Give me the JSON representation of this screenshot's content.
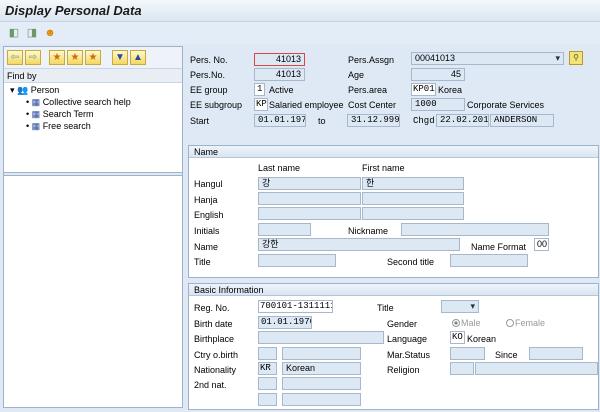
{
  "title": "Display Personal Data",
  "toolbar": {
    "icons": [
      "previous-record-icon",
      "next-record-icon",
      "person-overview-icon"
    ]
  },
  "left": {
    "toolbar_icons": [
      "back-icon",
      "forward-icon",
      "add-favorite-icon",
      "favorite-icon",
      "change-favorite-icon",
      "expand-icon",
      "collapse-icon"
    ],
    "find_by": "Find by",
    "root": "Person",
    "items": [
      "Collective search help",
      "Search Term",
      "Free search"
    ]
  },
  "header": {
    "pers_no_label": "Pers. No.",
    "pers_no": "41013",
    "pers_no2_label": "Pers.No.",
    "pers_no2": "41013",
    "ee_group_label": "EE group",
    "ee_group": "1",
    "ee_group_text": "Active",
    "ee_subgroup_label": "EE subgroup",
    "ee_subgroup": "KP",
    "ee_subgroup_text": "Salaried employee",
    "start_label": "Start",
    "start": "01.01.1970",
    "to_label": "to",
    "end": "31.12.9999",
    "pers_assgn_label": "Pers.Assgn",
    "pers_assgn": "00041013",
    "age_label": "Age",
    "age": "45",
    "pers_area_label": "Pers.area",
    "pers_area": "KP01",
    "pers_area_text": "Korea",
    "cost_center_label": "Cost Center",
    "cost_center": "1000",
    "cost_center_text": "Corporate Services",
    "chgd_label": "Chgd",
    "chgd_date": "22.02.2012",
    "chgd_user": "ANDERSON"
  },
  "name": {
    "title": "Name",
    "last_name_label": "Last name",
    "first_name_label": "First name",
    "hangul_label": "Hangul",
    "hangul_last": "강",
    "hangul_first": "한",
    "hanja_label": "Hanja",
    "english_label": "English",
    "initials_label": "Initials",
    "nickname_label": "Nickname",
    "name_label": "Name",
    "name_value": "강한",
    "name_format_label": "Name Format",
    "name_format": "00",
    "title_label": "Title",
    "second_title_label": "Second title"
  },
  "basic": {
    "title": "Basic Information",
    "reg_no_label": "Reg. No.",
    "reg_no": "700101-1311111",
    "birth_date_label": "Birth date",
    "birth_date": "01.01.1970",
    "birthplace_label": "Birthplace",
    "ctry_birth_label": "Ctry o.birth",
    "nationality_label": "Nationality",
    "nationality_code": "KR",
    "nationality_text": "Korean",
    "second_nat_label": "2nd nat.",
    "title_label": "Title",
    "gender_label": "Gender",
    "male_label": "Male",
    "female_label": "Female",
    "gender_selected": "Male",
    "language_label": "Language",
    "language_code": "KO",
    "language_text": "Korean",
    "mar_status_label": "Mar.Status",
    "since_label": "Since",
    "religion_label": "Religion"
  }
}
